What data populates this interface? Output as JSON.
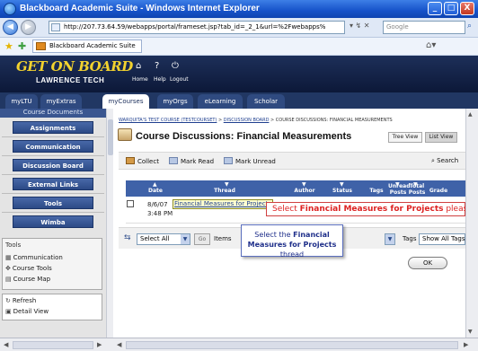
{
  "window": {
    "title": "Blackboard Academic Suite - Windows Internet Explorer",
    "minimize_label": "_",
    "maximize_label": "□",
    "close_label": "X"
  },
  "browser": {
    "back_label": "◀",
    "forward_label": "▶",
    "url": "http://207.73.64.59/webapps/portal/frameset.jsp?tab_id=_2_1&url=%2Fwebapps%",
    "search_placeholder": "Google",
    "favorites_tab": "Blackboard Academic Suite",
    "misc_icons": "▾ ↯ ✕"
  },
  "header": {
    "logo_main": "GET ON BOARD",
    "logo_sub": "LAWRENCE TECH",
    "links": [
      {
        "icon": "⌂",
        "label": "Home"
      },
      {
        "icon": "?",
        "label": "Help"
      },
      {
        "icon": "⏻",
        "label": "Logout"
      }
    ]
  },
  "tabs": [
    {
      "label": "myLTU",
      "active": false
    },
    {
      "label": "myExtras",
      "active": false
    },
    {
      "label": "myCourses",
      "active": true
    },
    {
      "label": "myOrgs",
      "active": false
    },
    {
      "label": "eLearning",
      "active": false
    },
    {
      "label": "Scholar",
      "active": false
    }
  ],
  "course_menu": {
    "header": "Course Documents",
    "items": [
      "Assignments",
      "Communication",
      "Discussion Board",
      "External Links",
      "Tools",
      "Wimba"
    ]
  },
  "tools": {
    "title": "Tools",
    "items": [
      {
        "icon": "▦",
        "label": "Communication"
      },
      {
        "icon": "✥",
        "label": "Course Tools"
      },
      {
        "icon": "▤",
        "label": "Course Map"
      }
    ],
    "refresh_items": [
      {
        "icon": "↻",
        "label": "Refresh"
      },
      {
        "icon": "▣",
        "label": "Detail View"
      }
    ]
  },
  "main": {
    "breadcrumb": {
      "part1": "WARQUITA'S TEST COURSE (TESTCOURSET)",
      "sep": " > ",
      "part2": "DISCUSSION BOARD",
      "part3": "COURSE DISCUSSIONS: FINANCIAL MEASUREMENTS"
    },
    "page_title": "Course Discussions: Financial Measurements",
    "view_buttons": {
      "tree": "Tree View",
      "list": "List View"
    },
    "actions": {
      "collect": "Collect",
      "mark_read": "Mark Read",
      "mark_unread": "Mark Unread",
      "search": "Search"
    },
    "columns": {
      "date": "Date",
      "thread": "Thread",
      "author": "Author",
      "status": "Status",
      "tags": "Tags",
      "unread_posts": "Unread Posts",
      "total_posts": "Total Posts",
      "grade": "Grade"
    },
    "rows": [
      {
        "date": "8/6/07",
        "time": "3:48 PM",
        "thread": "Financial Measures for Projects"
      }
    ],
    "callout": {
      "pre": "Select ",
      "bold": "Financial Measures for Projects",
      "post": " please"
    },
    "bottom": {
      "select_all": "Select All",
      "go": "Go",
      "items_per_page": "Items",
      "tags_label": "Tags",
      "tags_value": "Show All Tags"
    },
    "tooltip": {
      "pre": "Select the ",
      "bold": "Financial Measures for Projects",
      "post": " thread"
    },
    "ok_label": "OK"
  },
  "colors": {
    "header_bg": "#0c1838",
    "tab_bg": "#213763",
    "menu_button": "#2c4a86",
    "table_header": "#3f62a8",
    "callout_text": "#dd2222"
  }
}
